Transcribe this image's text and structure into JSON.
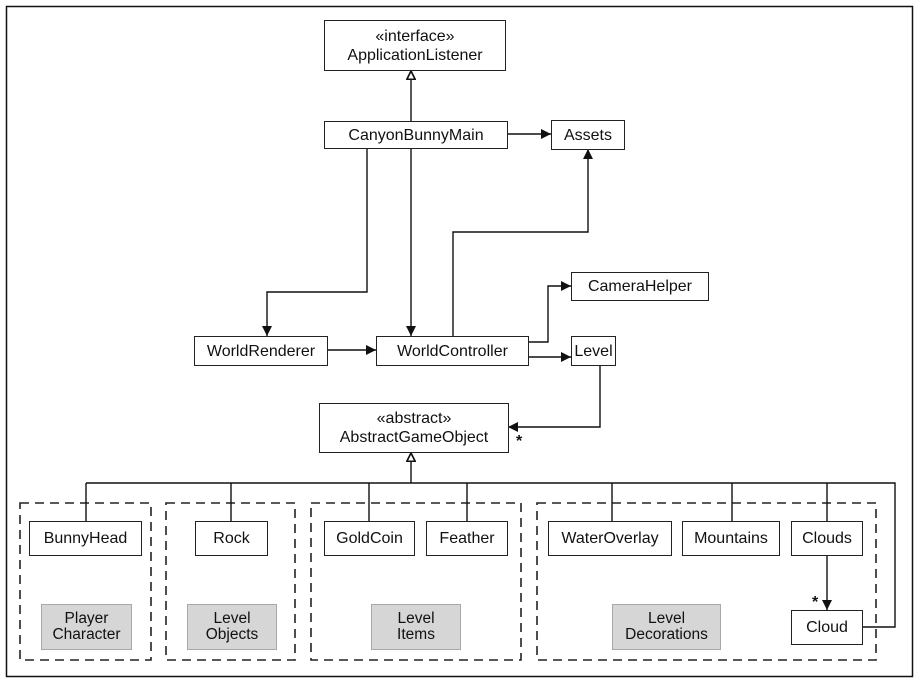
{
  "diagram": {
    "classes": {
      "application_listener": {
        "stereotype": "«interface»",
        "name": "ApplicationListener"
      },
      "canyon_bunny_main": {
        "name": "CanyonBunnyMain"
      },
      "assets": {
        "name": "Assets"
      },
      "camera_helper": {
        "name": "CameraHelper"
      },
      "world_renderer": {
        "name": "WorldRenderer"
      },
      "world_controller": {
        "name": "WorldController"
      },
      "level": {
        "name": "Level"
      },
      "abstract_game_object": {
        "stereotype": "«abstract»",
        "name": "AbstractGameObject"
      },
      "bunny_head": {
        "name": "BunnyHead"
      },
      "rock": {
        "name": "Rock"
      },
      "gold_coin": {
        "name": "GoldCoin"
      },
      "feather": {
        "name": "Feather"
      },
      "water_overlay": {
        "name": "WaterOverlay"
      },
      "mountains": {
        "name": "Mountains"
      },
      "clouds": {
        "name": "Clouds"
      },
      "cloud": {
        "name": "Cloud"
      }
    },
    "groups": [
      {
        "line1": "Player",
        "line2": "Character"
      },
      {
        "line1": "Level",
        "line2": "Objects"
      },
      {
        "line1": "Level",
        "line2": "Items"
      },
      {
        "line1": "Level",
        "line2": "Decorations"
      }
    ],
    "multiplicities": {
      "level_to_abstract": "*",
      "clouds_to_cloud": "*"
    },
    "relations": [
      {
        "from": "CanyonBunnyMain",
        "to": "ApplicationListener",
        "type": "realization"
      },
      {
        "from": "CanyonBunnyMain",
        "to": "Assets",
        "type": "association"
      },
      {
        "from": "CanyonBunnyMain",
        "to": "WorldRenderer",
        "type": "association"
      },
      {
        "from": "CanyonBunnyMain",
        "to": "WorldController",
        "type": "association"
      },
      {
        "from": "WorldController",
        "to": "Assets",
        "type": "association"
      },
      {
        "from": "WorldRenderer",
        "to": "WorldController",
        "type": "association"
      },
      {
        "from": "WorldController",
        "to": "CameraHelper",
        "type": "association"
      },
      {
        "from": "WorldController",
        "to": "Level",
        "type": "association"
      },
      {
        "from": "Level",
        "to": "AbstractGameObject",
        "type": "association",
        "multiplicity": "*"
      },
      {
        "from": "BunnyHead",
        "to": "AbstractGameObject",
        "type": "generalization"
      },
      {
        "from": "Rock",
        "to": "AbstractGameObject",
        "type": "generalization"
      },
      {
        "from": "GoldCoin",
        "to": "AbstractGameObject",
        "type": "generalization"
      },
      {
        "from": "Feather",
        "to": "AbstractGameObject",
        "type": "generalization"
      },
      {
        "from": "WaterOverlay",
        "to": "AbstractGameObject",
        "type": "generalization"
      },
      {
        "from": "Mountains",
        "to": "AbstractGameObject",
        "type": "generalization"
      },
      {
        "from": "Clouds",
        "to": "AbstractGameObject",
        "type": "generalization"
      },
      {
        "from": "Cloud",
        "to": "AbstractGameObject",
        "type": "generalization"
      },
      {
        "from": "Clouds",
        "to": "Cloud",
        "type": "association",
        "multiplicity": "*"
      }
    ]
  }
}
